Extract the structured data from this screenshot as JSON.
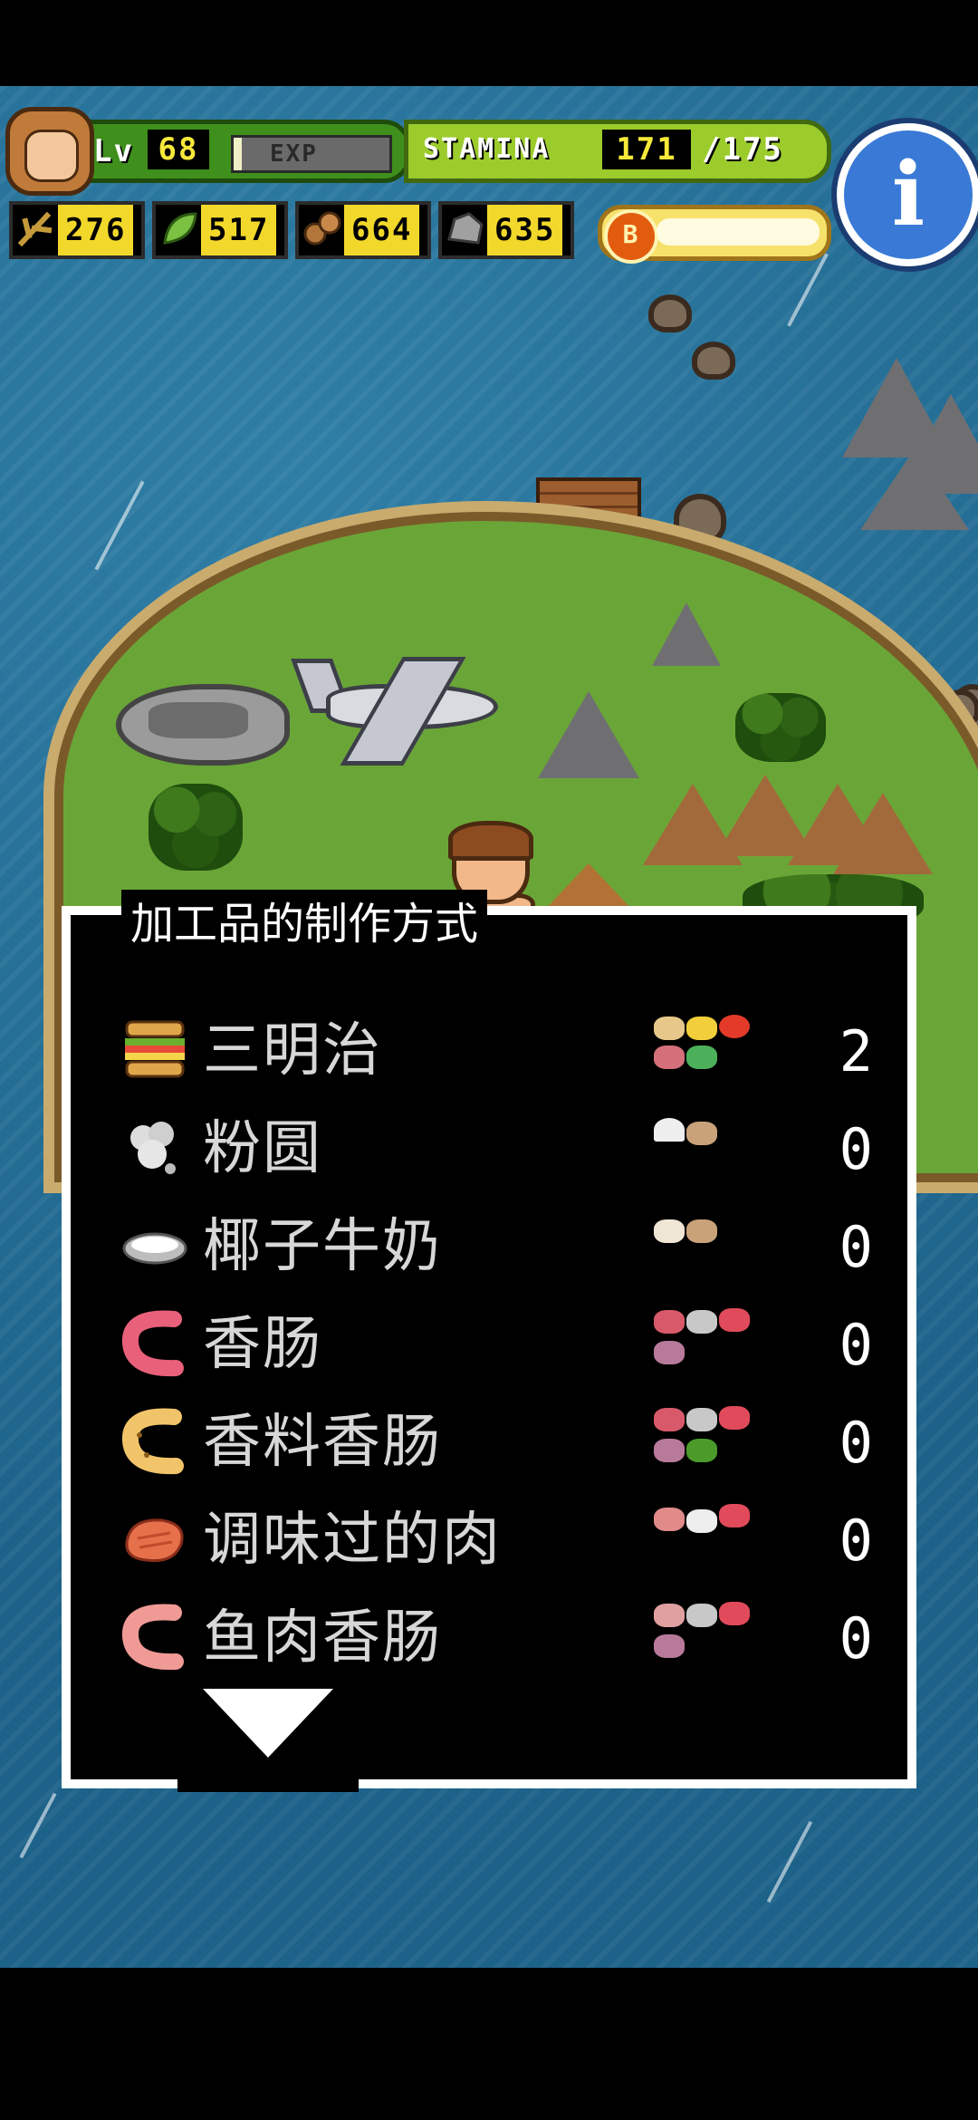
{
  "hud": {
    "level_label": "Lv",
    "level": "68",
    "exp_label": "EXP",
    "exp_progress": 0.05,
    "stamina_label": "STAMINA",
    "stamina": "171",
    "stamina_max": "/175",
    "info_glyph": "i"
  },
  "resources": [
    {
      "icon": "branch-icon",
      "value": "276"
    },
    {
      "icon": "leaf-icon",
      "value": "517"
    },
    {
      "icon": "nuts-icon",
      "value": "664"
    },
    {
      "icon": "stone-icon",
      "value": "635"
    }
  ],
  "coin": {
    "badge": "B",
    "icon": "coin-icon"
  },
  "panel": {
    "title": "加工品的制作方式",
    "recipes": [
      {
        "name": "三明治",
        "count": "2",
        "icon": "sandwich-icon"
      },
      {
        "name": "粉圆",
        "count": "0",
        "icon": "tapioca-icon"
      },
      {
        "name": "椰子牛奶",
        "count": "0",
        "icon": "coconut-milk-icon"
      },
      {
        "name": "香肠",
        "count": "0",
        "icon": "sausage-icon"
      },
      {
        "name": "香料香肠",
        "count": "0",
        "icon": "spiced-sausage-icon"
      },
      {
        "name": "调味过的肉",
        "count": "0",
        "icon": "seasoned-meat-icon"
      },
      {
        "name": "鱼肉香肠",
        "count": "0",
        "icon": "fish-sausage-icon"
      }
    ]
  },
  "colors": {
    "panel_bg": "#000000",
    "panel_border": "#ffffff",
    "level_bar": "#3f8f1d",
    "stamina_bar": "#9ccb2c",
    "resource_bg": "#f2d82a",
    "info_button": "#3a7ad6"
  }
}
